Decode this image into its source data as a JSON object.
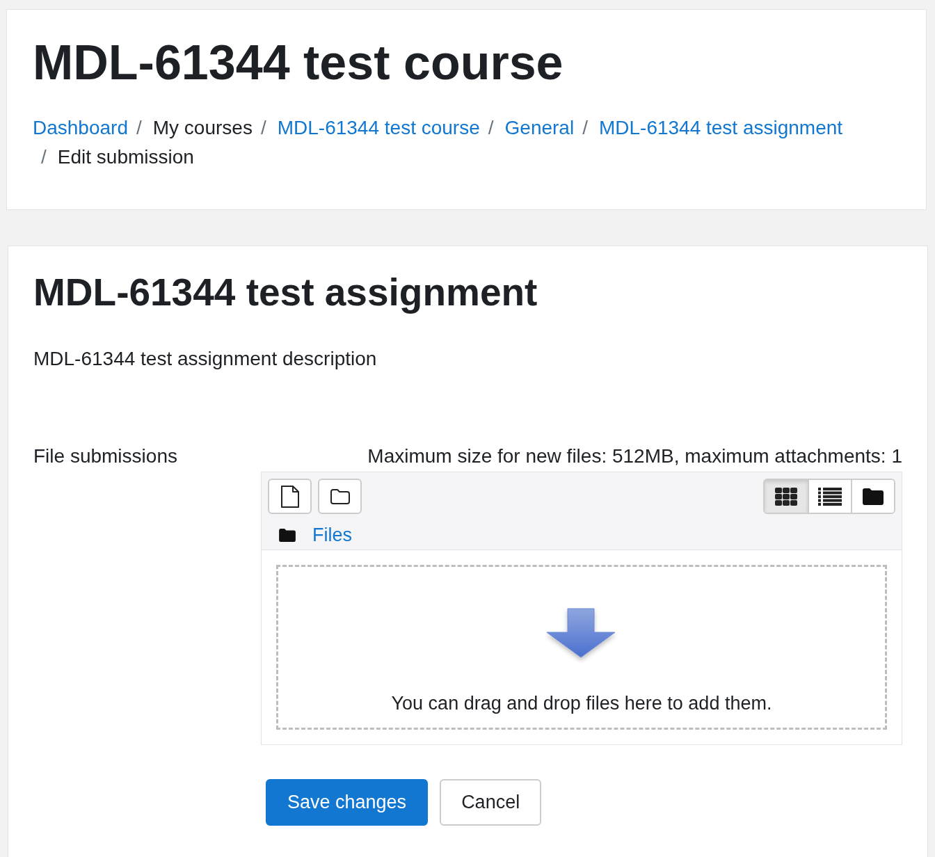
{
  "header": {
    "title": "MDL-61344 test course",
    "breadcrumb": [
      {
        "label": "Dashboard",
        "kind": "link"
      },
      {
        "label": "My courses",
        "kind": "text"
      },
      {
        "label": "MDL-61344 test course",
        "kind": "link"
      },
      {
        "label": "General",
        "kind": "link"
      },
      {
        "label": "MDL-61344 test assignment",
        "kind": "link"
      },
      {
        "label": "Edit submission",
        "kind": "text"
      }
    ],
    "separator": "/"
  },
  "main": {
    "title": "MDL-61344 test assignment",
    "description": "MDL-61344 test assignment description",
    "form": {
      "label": "File submissions",
      "limits": "Maximum size for new files: 512MB, maximum attachments: 1",
      "filemanager": {
        "actions": [
          {
            "kind": "add-file"
          },
          {
            "kind": "add-folder"
          }
        ],
        "view_modes": [
          {
            "kind": "icons",
            "selected": true
          },
          {
            "kind": "list",
            "selected": false
          },
          {
            "kind": "tree",
            "selected": false
          }
        ],
        "path": "Files",
        "drop_hint": "You can drag and drop files here to add them."
      },
      "buttons": [
        {
          "label": "Save changes",
          "kind": "primary"
        },
        {
          "label": "Cancel",
          "kind": "secondary"
        }
      ]
    }
  }
}
